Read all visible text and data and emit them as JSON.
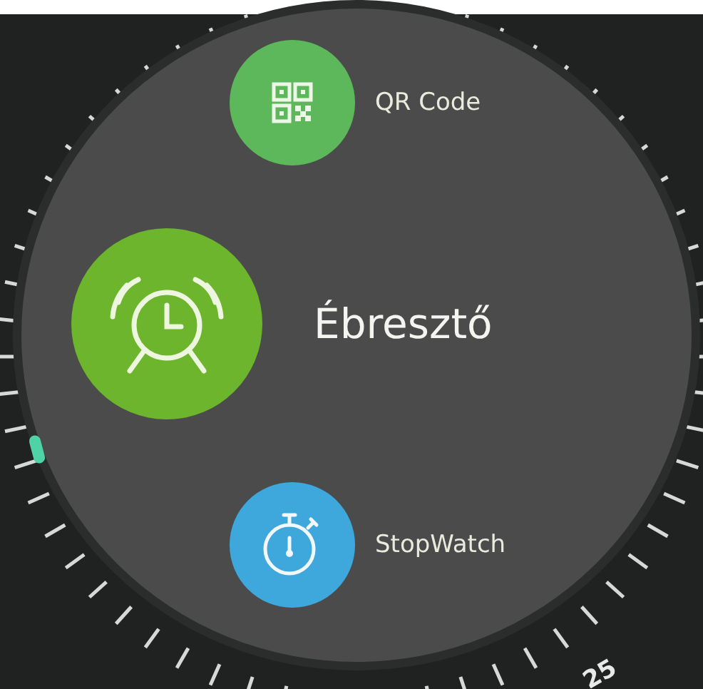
{
  "apps": [
    {
      "kind": "qr",
      "label": "QR Code",
      "color": "#5cb85a",
      "selected": false
    },
    {
      "kind": "alarm",
      "label": "Ébresztő",
      "color": "#6cb52c",
      "selected": true
    },
    {
      "kind": "stopwatch",
      "label": "StopWatch",
      "color": "#3ea8dc",
      "selected": false
    }
  ],
  "bezel": {
    "number": "25"
  }
}
